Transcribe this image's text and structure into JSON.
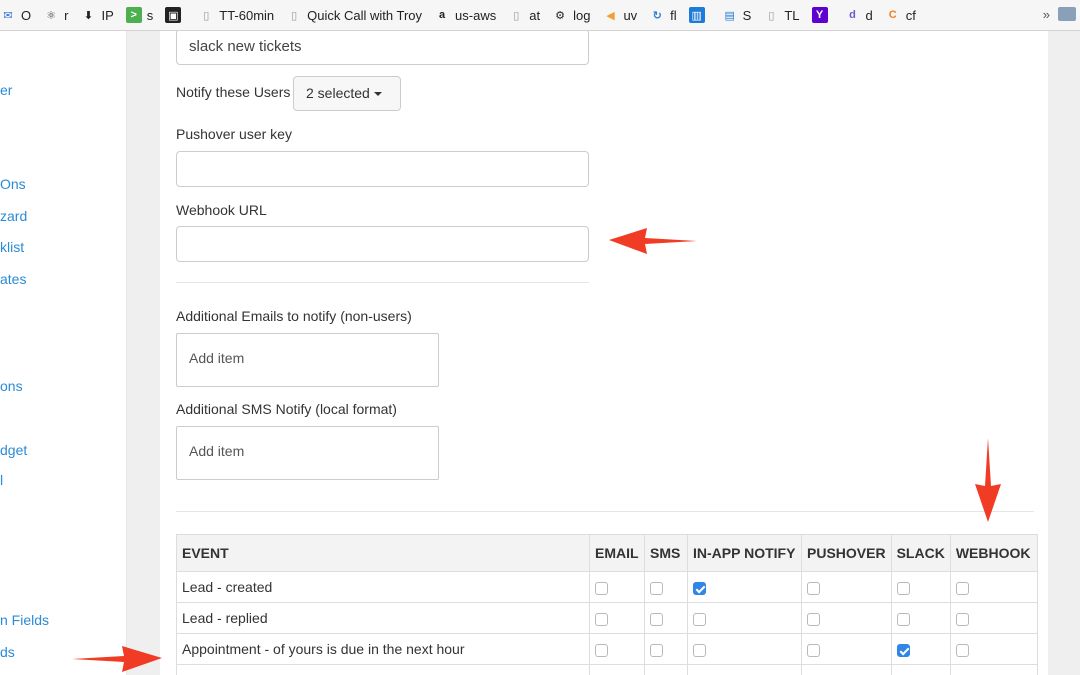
{
  "bookmarks": [
    {
      "icon": "mail-icon",
      "label": "O",
      "color": "#2f6fd6"
    },
    {
      "icon": "react-icon",
      "label": "r",
      "color": "#333"
    },
    {
      "icon": "download-circle-icon",
      "label": "IP",
      "color": "#222"
    },
    {
      "icon": "terminal-icon",
      "label": "s",
      "color": "#4caf50"
    },
    {
      "icon": "image-icon",
      "label": "",
      "color": "#222"
    },
    {
      "icon": "page-icon",
      "label": "TT-60min",
      "color": "#999"
    },
    {
      "icon": "page-icon",
      "label": "Quick Call with Troy",
      "color": "#999"
    },
    {
      "icon": "amazon-icon",
      "label": "us-aws",
      "color": "#222"
    },
    {
      "icon": "page-icon",
      "label": "at",
      "color": "#999"
    },
    {
      "icon": "gear-icon",
      "label": "log",
      "color": "#222"
    },
    {
      "icon": "megaphone-icon",
      "label": "uv",
      "color": "#f0a030"
    },
    {
      "icon": "sync-icon",
      "label": "fl",
      "color": "#2a7bd6"
    },
    {
      "icon": "trello-icon",
      "label": "",
      "color": "#1f7bd8"
    },
    {
      "icon": "layout-icon",
      "label": "S",
      "color": "#2a7bd6"
    },
    {
      "icon": "page-icon",
      "label": "TL",
      "color": "#999"
    },
    {
      "icon": "yahoo-icon",
      "label": "",
      "color": "#5f01d1"
    },
    {
      "icon": "d-icon",
      "label": "d",
      "color": "#6a5acd"
    },
    {
      "icon": "cf-icon",
      "label": "cf",
      "color": "#f38020"
    }
  ],
  "bookmarks_more": "»",
  "sidebar": {
    "items": [
      "er",
      "Ons",
      "zard",
      "klist",
      "ates",
      "ons",
      "dget",
      "l",
      "n Fields",
      "ds"
    ]
  },
  "form": {
    "name_value": "slack new tickets",
    "notify_users_label": "Notify these Users",
    "notify_users_value": "2 selected",
    "pushover_label": "Pushover user key",
    "pushover_value": "",
    "webhook_label": "Webhook URL",
    "webhook_value": "",
    "emails_label": "Additional Emails to notify (non-users)",
    "emails_placeholder": "Add item",
    "sms_label": "Additional SMS Notify (local format)",
    "sms_placeholder": "Add item"
  },
  "table": {
    "columns": [
      "EVENT",
      "EMAIL",
      "SMS",
      "IN-APP NOTIFY",
      "PUSHOVER",
      "SLACK",
      "WEBHOOK"
    ],
    "rows": [
      {
        "event": "Lead - created",
        "checks": [
          false,
          false,
          true,
          false,
          false,
          false
        ]
      },
      {
        "event": "Lead - replied",
        "checks": [
          false,
          false,
          false,
          false,
          false,
          false
        ]
      },
      {
        "event": "Appointment - of yours is due in the next hour",
        "checks": [
          false,
          false,
          false,
          false,
          true,
          false
        ]
      },
      {
        "event": "",
        "checks": [
          false,
          false,
          false,
          false,
          true,
          false
        ]
      }
    ]
  },
  "colors": {
    "accent": "#2f86e6",
    "link": "#2a8bd6",
    "annotation": "#f03c24"
  }
}
